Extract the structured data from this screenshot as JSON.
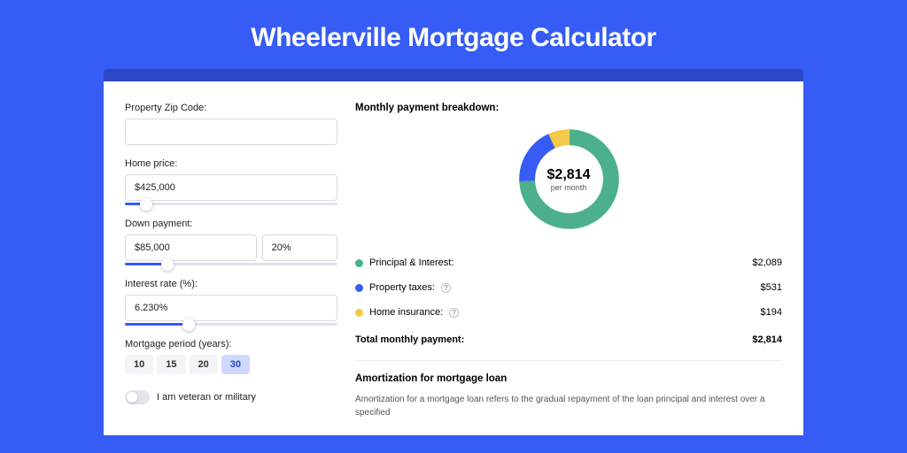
{
  "page_title": "Wheelerville Mortgage Calculator",
  "form": {
    "zip": {
      "label": "Property Zip Code:",
      "value": ""
    },
    "home_price": {
      "label": "Home price:",
      "value": "$425,000",
      "slider_pct": 10
    },
    "down_payment": {
      "label": "Down payment:",
      "amount": "$85,000",
      "pct": "20%",
      "slider_pct": 20
    },
    "interest": {
      "label": "Interest rate (%):",
      "value": "6.230%",
      "slider_pct": 30
    },
    "period": {
      "label": "Mortgage period (years):",
      "options": [
        "10",
        "15",
        "20",
        "30"
      ],
      "active": "30"
    },
    "veteran": {
      "label": "I am veteran or military",
      "on": false
    }
  },
  "breakdown": {
    "title": "Monthly payment breakdown:",
    "center_amount": "$2,814",
    "center_sub": "per month",
    "items": [
      {
        "label": "Principal & Interest:",
        "value": "$2,089",
        "has_info": false
      },
      {
        "label": "Property taxes:",
        "value": "$531",
        "has_info": true
      },
      {
        "label": "Home insurance:",
        "value": "$194",
        "has_info": true
      }
    ],
    "total_label": "Total monthly payment:",
    "total_value": "$2,814"
  },
  "chart_data": {
    "type": "pie",
    "title": "Monthly payment breakdown",
    "series": [
      {
        "name": "Principal & Interest",
        "value": 2089,
        "color": "#4bb08b"
      },
      {
        "name": "Property taxes",
        "value": 531,
        "color": "#365cf5"
      },
      {
        "name": "Home insurance",
        "value": 194,
        "color": "#f4c947"
      }
    ],
    "total": 2814,
    "unit": "USD/month"
  },
  "amort": {
    "title": "Amortization for mortgage loan",
    "text": "Amortization for a mortgage loan refers to the gradual repayment of the loan principal and interest over a specified"
  }
}
